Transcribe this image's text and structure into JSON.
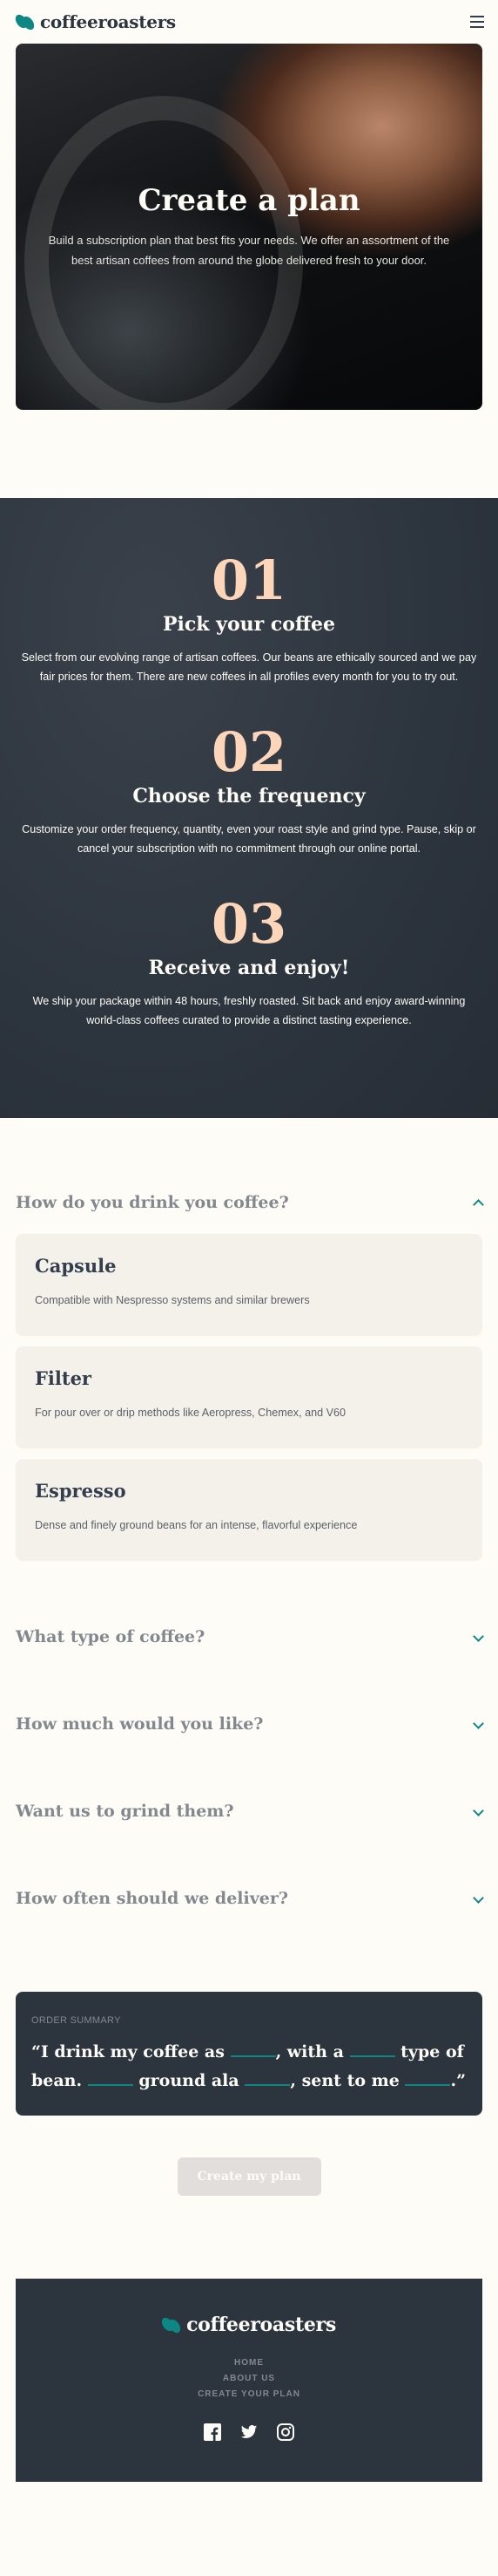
{
  "header": {
    "logo_text": "coffeeroasters",
    "menu_icon": "hamburger-icon"
  },
  "hero": {
    "title": "Create a plan",
    "text": "Build a subscription plan that best fits your needs. We offer an assortment of the best artisan coffees from around the globe delivered fresh to your door."
  },
  "steps": [
    {
      "number": "01",
      "title": "Pick your coffee",
      "text": "Select from our evolving range of artisan coffees. Our beans are ethically sourced and we pay fair prices for them. There are new coffees in all profiles every month for you to try out."
    },
    {
      "number": "02",
      "title": "Choose the frequency",
      "text": "Customize your order frequency, quantity, even your roast style and grind type. Pause, skip or cancel your subscription with no commitment through our online portal."
    },
    {
      "number": "03",
      "title": "Receive and enjoy!",
      "text": "We ship your package within 48 hours, freshly roasted. Sit back and enjoy award-winning world-class coffees curated to provide a distinct tasting experience."
    }
  ],
  "questions": [
    {
      "title": "How do you drink you coffee?",
      "options": [
        {
          "title": "Capsule",
          "desc": "Compatible with Nespresso systems and similar brewers"
        },
        {
          "title": "Filter",
          "desc": "For pour over or drip methods like Aeropress, Chemex, and V60"
        },
        {
          "title": "Espresso",
          "desc": "Dense and finely ground beans for an intense, flavorful experience"
        }
      ]
    },
    {
      "title": "What type of coffee?"
    },
    {
      "title": "How much would you like?"
    },
    {
      "title": "Want us to grind them?"
    },
    {
      "title": "How often should we deliver?"
    }
  ],
  "summary": {
    "label": "Order Summary",
    "part1": "“I drink my coffee as",
    "part2": ", with a",
    "part3": "type of bean.",
    "part4": "ground ala",
    "part5": ", sent to me",
    "part6": ".”"
  },
  "cta_label": "Create my plan",
  "footer": {
    "logo_text": "coffeeroasters",
    "nav": [
      "Home",
      "About Us",
      "Create Your Plan"
    ],
    "social": [
      "facebook-icon",
      "twitter-icon",
      "instagram-icon"
    ]
  },
  "colors": {
    "accent": "#0e8784",
    "dark": "#2c343e",
    "peach": "#fdd6ba",
    "cream": "#fefcf7",
    "disabled": "#e2dedb"
  }
}
